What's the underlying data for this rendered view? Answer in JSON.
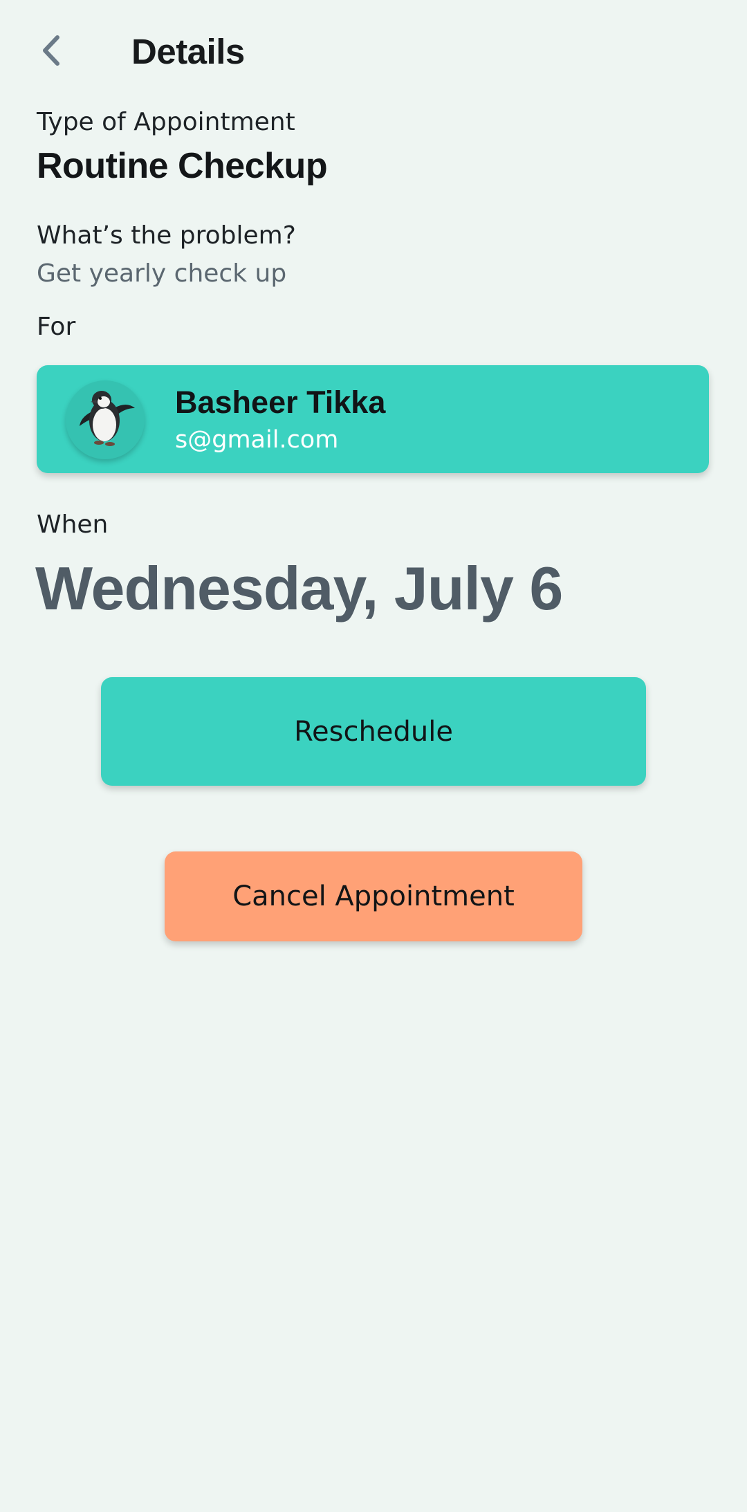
{
  "header": {
    "title": "Details",
    "back_icon": "chevron-left-icon"
  },
  "appointment": {
    "type_label": "Type of Appointment",
    "type_value": "Routine Checkup",
    "problem_label": "What’s the problem?",
    "problem_value": "Get yearly check up",
    "for_label": "For"
  },
  "patient": {
    "name": "Basheer Tikka",
    "email": "s@gmail.com",
    "avatar_icon": "penguin-avatar"
  },
  "schedule": {
    "when_label": "When",
    "date": "Wednesday, July 6"
  },
  "actions": {
    "reschedule_label": "Reschedule",
    "cancel_label": "Cancel Appointment"
  },
  "colors": {
    "background": "#eef5f2",
    "accent_teal": "#3bd2c0",
    "cancel_orange": "#ffa176",
    "date_gray": "#505c66",
    "secondary_text": "#5b6770"
  }
}
